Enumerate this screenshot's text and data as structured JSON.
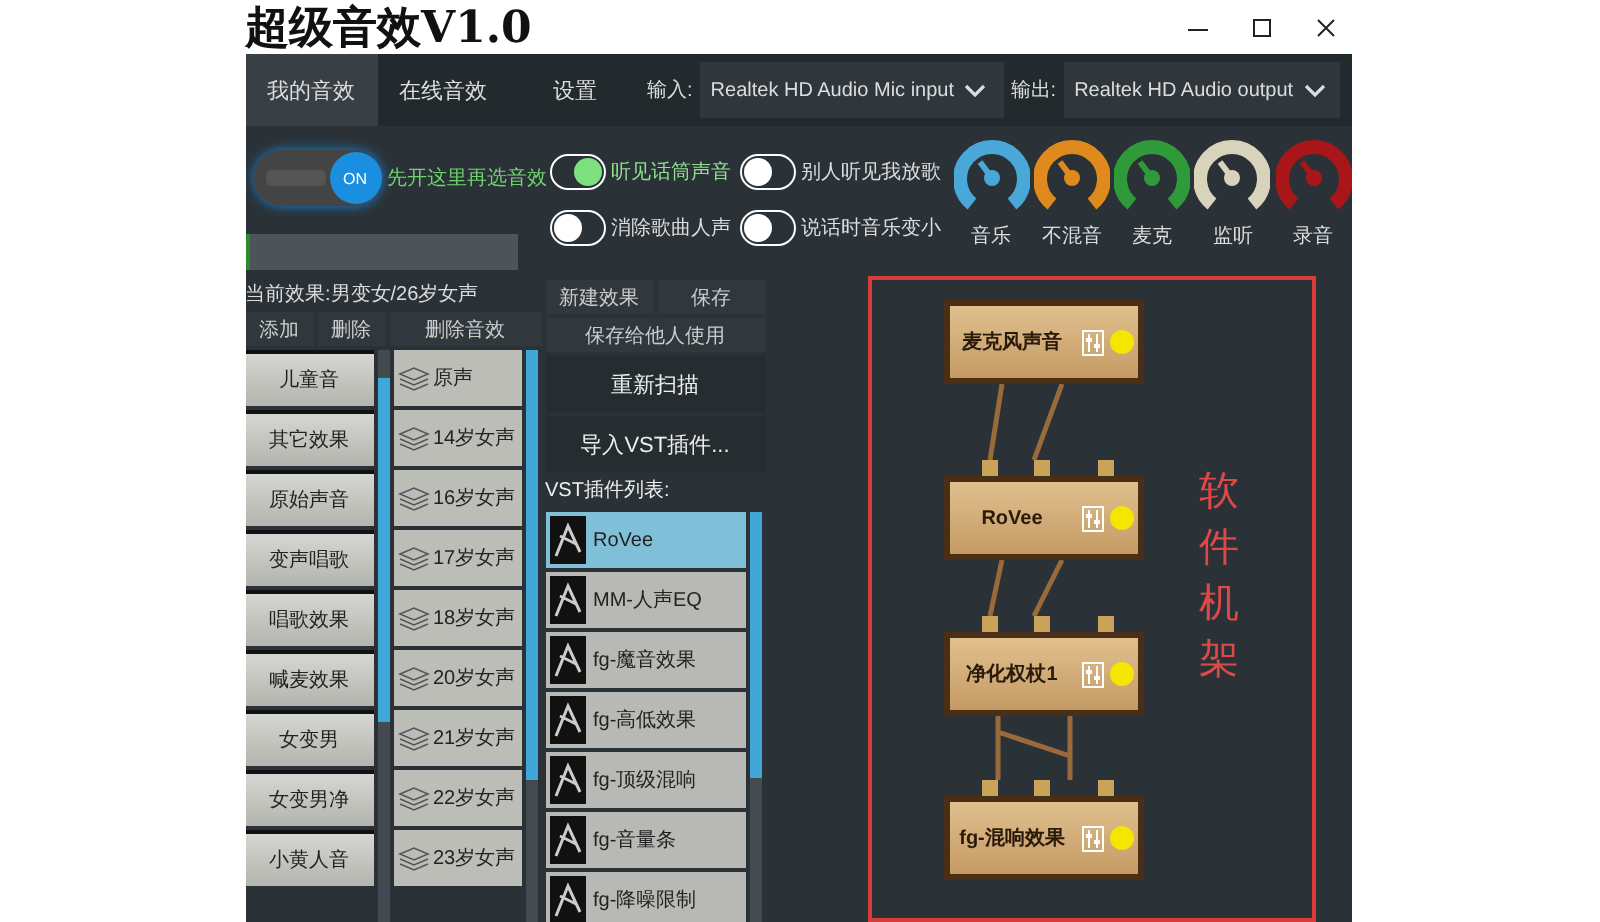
{
  "window": {
    "title": "超级音效V1.0"
  },
  "tabs": [
    {
      "label": "我的音效",
      "selected": true
    },
    {
      "label": "在线音效",
      "selected": false
    },
    {
      "label": "设置",
      "selected": false
    }
  ],
  "input": {
    "label": "输入:",
    "value": "Realtek HD Audio Mic input"
  },
  "output": {
    "label": "输出:",
    "value": "Realtek HD Audio output"
  },
  "master": {
    "on": true,
    "label": "ON",
    "hint": "先开这里再选音效",
    "level": 0.02
  },
  "switches": [
    {
      "label": "听见话筒声音",
      "on": true
    },
    {
      "label": "别人听见我放歌",
      "on": false
    },
    {
      "label": "消除歌曲人声",
      "on": false
    },
    {
      "label": "说话时音乐变小",
      "on": false
    }
  ],
  "knobs": [
    {
      "label": "音乐",
      "color": "#4aa8d8"
    },
    {
      "label": "不混音",
      "color": "#e08a1e"
    },
    {
      "label": "麦克",
      "color": "#2e9a3a"
    },
    {
      "label": "监听",
      "color": "#d8d4bc"
    },
    {
      "label": "录音",
      "color": "#a8161a"
    }
  ],
  "current_effect": "当前效果:男变女/26岁女声",
  "list_buttons": [
    "添加",
    "删除",
    "删除音效"
  ],
  "categories": [
    "儿童音",
    "其它效果",
    "原始声音",
    "变声唱歌",
    "唱歌效果",
    "喊麦效果",
    "女变男",
    "女变男净",
    "小黄人音"
  ],
  "presets": [
    "原声",
    "14岁女声",
    "16岁女声",
    "17岁女声",
    "18岁女声",
    "20岁女声",
    "21岁女声",
    "22岁女声",
    "23岁女声"
  ],
  "vst_buttons": {
    "top": [
      "新建效果",
      "保存"
    ],
    "share": "保存给他人使用",
    "rescan": "重新扫描",
    "import": "导入VST插件..."
  },
  "vst_list": {
    "title": "VST插件列表:",
    "items": [
      {
        "label": "RoVee",
        "selected": true
      },
      {
        "label": "MM-人声EQ",
        "selected": false
      },
      {
        "label": "fg-魔音效果",
        "selected": false
      },
      {
        "label": "fg-高低效果",
        "selected": false
      },
      {
        "label": "fg-顶级混响",
        "selected": false
      },
      {
        "label": "fg-音量条",
        "selected": false
      },
      {
        "label": "fg-降噪限制",
        "selected": false
      }
    ]
  },
  "rack": {
    "annotation": "软件机架",
    "nodes": [
      {
        "label": "麦克风声音"
      },
      {
        "label": "RoVee"
      },
      {
        "label": "净化权杖1"
      },
      {
        "label": "fg-混响效果"
      }
    ]
  }
}
